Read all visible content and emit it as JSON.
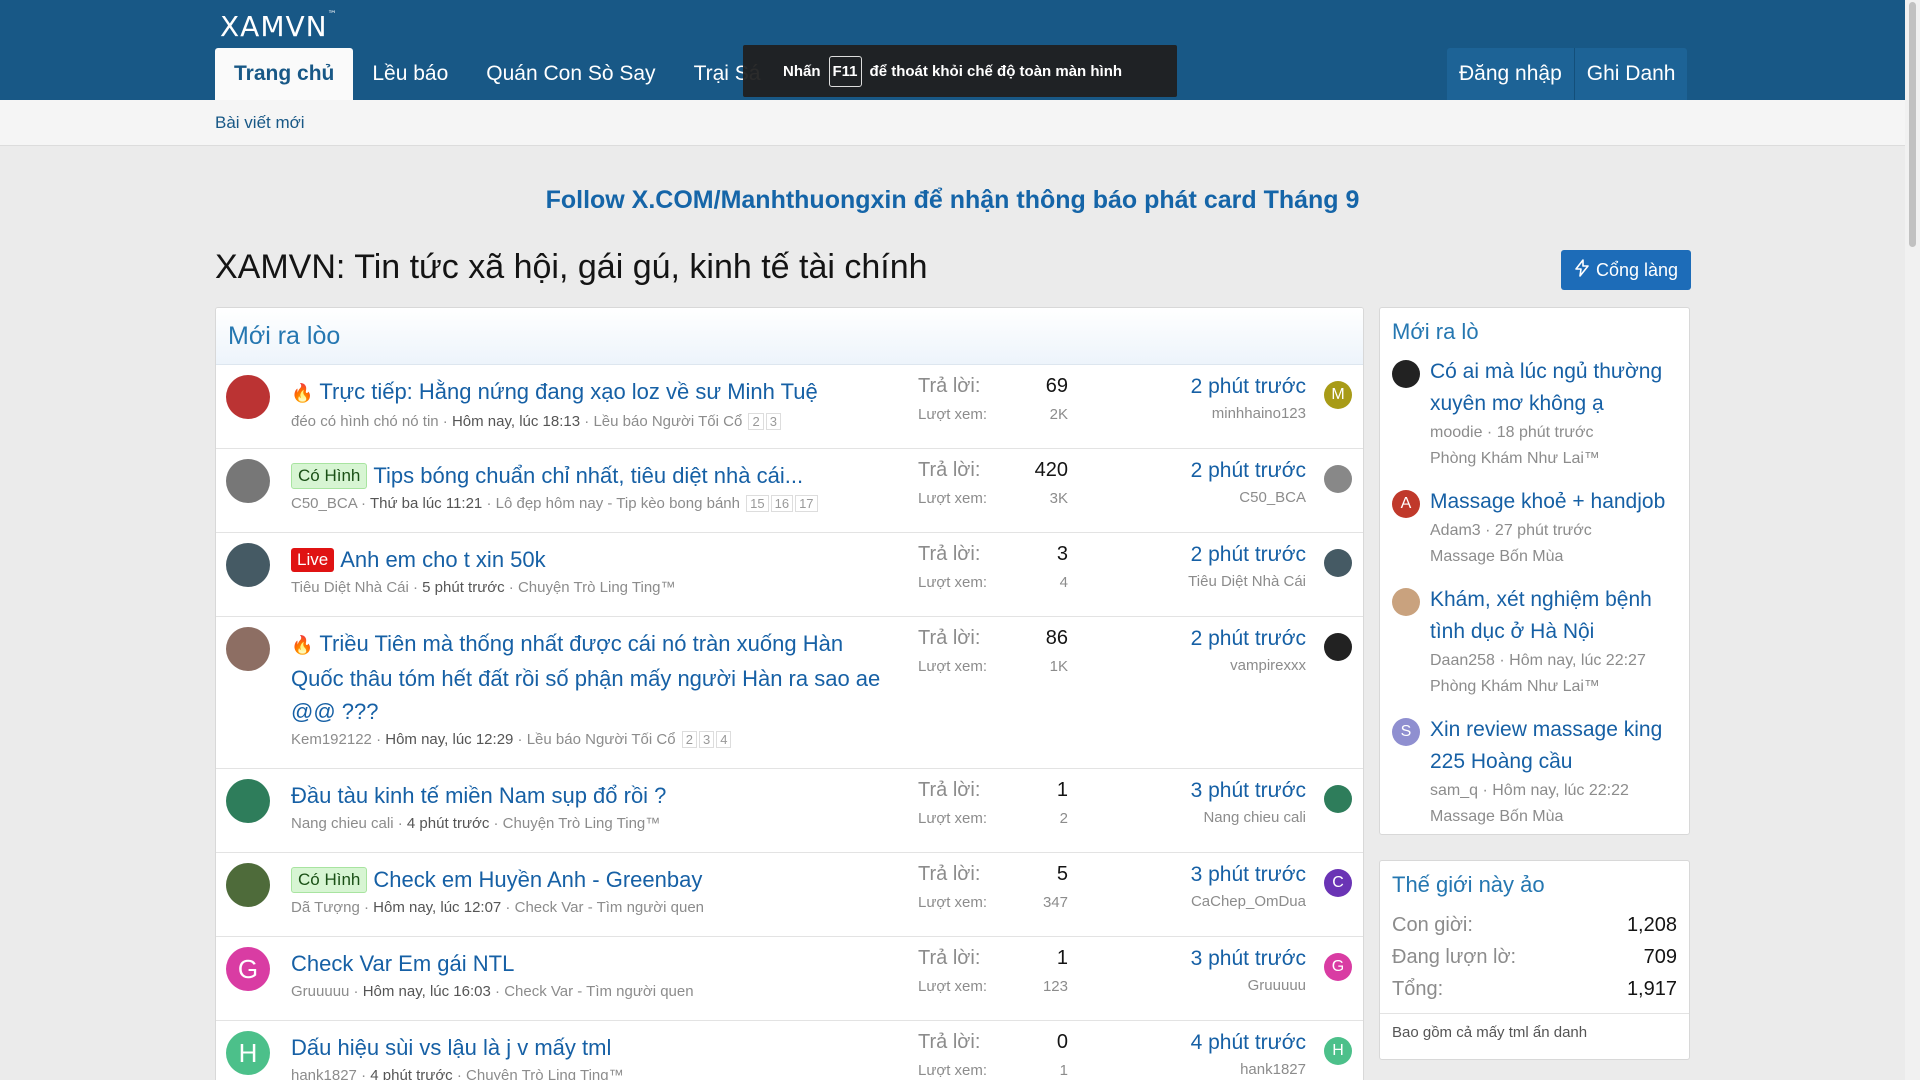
{
  "header": {
    "logo": "XAMVN",
    "logo_tm": "™",
    "tabs": [
      {
        "label": "Trang chủ"
      },
      {
        "label": "Lều báo"
      },
      {
        "label": "Quán Con Sò Say"
      },
      {
        "label": "Trại Sá"
      }
    ],
    "login": "Đăng nhập",
    "register": "Ghi Danh"
  },
  "fullscreen_toast": {
    "before": "Nhấn",
    "key": "F11",
    "after": "để thoát khỏi chế độ toàn màn hình"
  },
  "sub_nav": {
    "new_posts": "Bài viết mới"
  },
  "notice": "Follow X.COM/Manhthuongxin để nhận thông báo phát card Tháng 9",
  "page_title": "XAMVN: Tin tức xã hội, gái gú, kinh tế tài chính",
  "portal_button": "Cổng làng",
  "main_block": {
    "title": "Mới ra lòo",
    "replies_label": "Trả lời:",
    "views_label": "Lượt xem:",
    "threads": [
      {
        "prefix": "",
        "hot": true,
        "title": "Trực tiếp: Hằng nứng đang xạo loz về sư Minh Tuệ",
        "author": "đéo có hình chó nó tin",
        "date": "Hôm nay, lúc 18:13",
        "forum": "Lều báo Người Tối Cổ",
        "pages": [
          "2",
          "3"
        ],
        "replies": "69",
        "views": "2K",
        "last_time": "2 phút trước",
        "last_user": "minhhaino123",
        "avatar_letter": "",
        "mini_letter": "M"
      },
      {
        "prefix": "Có Hình",
        "hot": false,
        "title": "Tips bóng chuẩn chỉ nhất, tiêu diệt nhà cái...",
        "author": "C50_BCA",
        "date": "Thứ ba lúc 11:21",
        "forum": "Lô đẹp hôm nay - Tip kèo bong bánh",
        "pages": [
          "15",
          "16",
          "17"
        ],
        "replies": "420",
        "views": "3K",
        "last_time": "2 phút trước",
        "last_user": "C50_BCA",
        "avatar_letter": "",
        "mini_letter": ""
      },
      {
        "prefix": "Live",
        "hot": false,
        "title": "Anh em cho t xin 50k",
        "author": "Tiêu Diệt Nhà Cái",
        "date": "5 phút trước",
        "forum": "Chuyện Trò Ling Ting™",
        "pages": [],
        "replies": "3",
        "views": "4",
        "last_time": "2 phút trước",
        "last_user": "Tiêu Diệt Nhà Cái",
        "avatar_letter": "",
        "mini_letter": ""
      },
      {
        "prefix": "",
        "hot": true,
        "title": "Triều Tiên mà thống nhất được cái nó tràn xuống Hàn Quốc thâu tóm hết đất rồi số phận mấy người Hàn ra sao ae @@ ???",
        "author": "Kem192122",
        "date": "Hôm nay, lúc 12:29",
        "forum": "Lều báo Người Tối Cổ",
        "pages": [
          "2",
          "3",
          "4"
        ],
        "replies": "86",
        "views": "1K",
        "last_time": "2 phút trước",
        "last_user": "vampirexxx",
        "avatar_letter": "",
        "mini_letter": ""
      },
      {
        "prefix": "",
        "hot": false,
        "title": "Đầu tàu kinh tế miền Nam sụp đổ rồi ?",
        "author": "Nang chieu cali",
        "date": "4 phút trước",
        "forum": "Chuyện Trò Ling Ting™",
        "pages": [],
        "replies": "1",
        "views": "2",
        "last_time": "3 phút trước",
        "last_user": "Nang chieu cali",
        "avatar_letter": "",
        "mini_letter": ""
      },
      {
        "prefix": "Có Hình",
        "hot": false,
        "title": "Check em Huyền Anh - Greenbay",
        "author": "Dã Tượng",
        "date": "Hôm nay, lúc 12:07",
        "forum": "Check Var - Tìm người quen",
        "pages": [],
        "replies": "5",
        "views": "347",
        "last_time": "3 phút trước",
        "last_user": "CaChep_OmDua",
        "avatar_letter": "",
        "mini_letter": "C"
      },
      {
        "prefix": "",
        "hot": false,
        "title": "Check Var Em gái NTL",
        "author": "Gruuuuu",
        "date": "Hôm nay, lúc 16:03",
        "forum": "Check Var - Tìm người quen",
        "pages": [],
        "replies": "1",
        "views": "123",
        "last_time": "3 phút trước",
        "last_user": "Gruuuuu",
        "avatar_letter": "G",
        "mini_letter": "G"
      },
      {
        "prefix": "",
        "hot": false,
        "title": "Dấu hiệu sùi vs lậu là j v mấy tml",
        "author": "hank1827",
        "date": "4 phút trước",
        "forum": "Chuyện Trò Ling Ting™",
        "pages": [],
        "replies": "0",
        "views": "1",
        "last_time": "4 phút trước",
        "last_user": "hank1827",
        "avatar_letter": "H",
        "mini_letter": "H"
      }
    ]
  },
  "sidebar_new": {
    "title": "Mới ra lò",
    "items": [
      {
        "title": "Có ai mà lúc ngủ thường xuyên mơ không ạ",
        "user": "moodie",
        "time": "18 phút trước",
        "forum": "Phòng Khám Như Lai™",
        "letter": ""
      },
      {
        "title": "Massage khoẻ + handjob",
        "user": "Adam3",
        "time": "27 phút trước",
        "forum": "Massage Bốn Mùa",
        "letter": "A"
      },
      {
        "title": "Khám, xét nghiệm bệnh tình dục ở Hà Nội",
        "user": "Daan258",
        "time": "Hôm nay, lúc 22:27",
        "forum": "Phòng Khám Như Lai™",
        "letter": ""
      },
      {
        "title": "Xin review massage king 225 Hoàng cầu",
        "user": "sam_q",
        "time": "Hôm nay, lúc 22:22",
        "forum": "Massage Bốn Mùa",
        "letter": "S"
      }
    ]
  },
  "sidebar_online": {
    "title": "Thế giới này ảo",
    "rows": [
      {
        "label": "Con giời:",
        "value": "1,208"
      },
      {
        "label": "Đang lượn lờ:",
        "value": "709"
      },
      {
        "label": "Tổng:",
        "value": "1,917"
      }
    ],
    "footer": "Bao gồm cả mấy tml ẩn danh"
  },
  "colors": {
    "header_bg": "#185886",
    "link": "#1660a5",
    "accent": "#2577b1",
    "button": "#1d6cb8"
  }
}
